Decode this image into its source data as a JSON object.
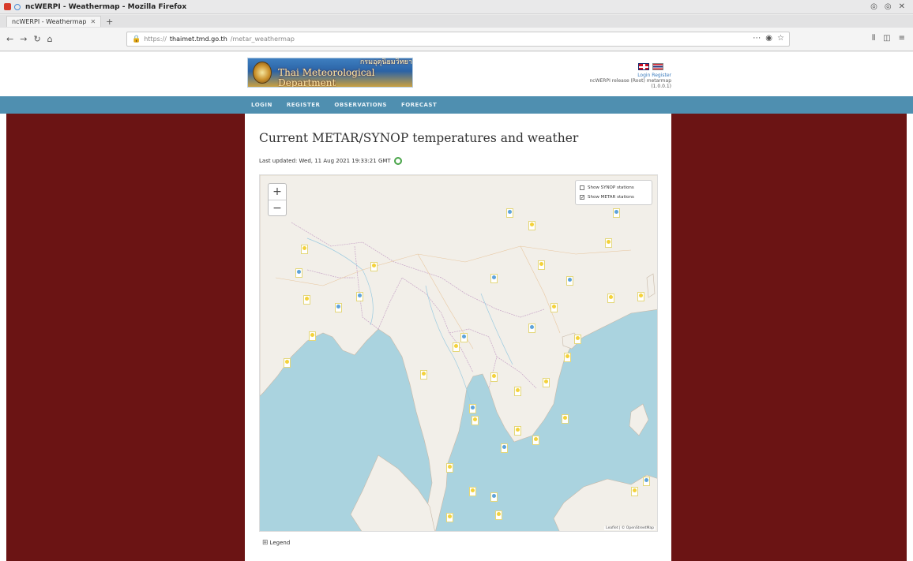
{
  "browser": {
    "window_title": "ncWERPI - Weathermap - Mozilla Firefox",
    "tab_label": "ncWERPI - Weathermap",
    "url_host": "thaimet.tmd.go.th",
    "url_prefix": "https://",
    "url_path": "/metar_weathermap"
  },
  "header": {
    "logo_thai": "กรมอุตุนิยมวิทยา",
    "logo_en": "Thai Meteorological Department",
    "link_login": "Login",
    "link_register": "Register",
    "status_line": "ncWERPI release (Root) metarmap (1.0.0.1)"
  },
  "menu": [
    {
      "label": "LOGIN"
    },
    {
      "label": "REGISTER"
    },
    {
      "label": "OBSERVATIONS"
    },
    {
      "label": "FORECAST"
    }
  ],
  "content": {
    "title": "Current METAR/SYNOP temperatures and weather",
    "last_updated": "Last updated: Wed, 11 Aug 2021 19:33:21 GMT",
    "legend_label": "Legend"
  },
  "map": {
    "zoom_in": "+",
    "zoom_out": "−",
    "layers": [
      {
        "label": "Show SYNOP stations",
        "checked": false
      },
      {
        "label": "Show METAR stations",
        "checked": true
      }
    ],
    "attribution": "Leaflet | © OpenStreetMap"
  },
  "colors": {
    "sidebar": "#6b1414",
    "menubar": "#4f8fb0",
    "sea": "#aad3df",
    "land": "#f2efe9"
  },
  "icons": {
    "back": "arrow-left-icon",
    "forward": "arrow-right-icon",
    "reload": "reload-icon",
    "home": "home-icon",
    "lock": "lock-icon",
    "legend": "legend-icon",
    "refresh": "refresh-icon"
  }
}
